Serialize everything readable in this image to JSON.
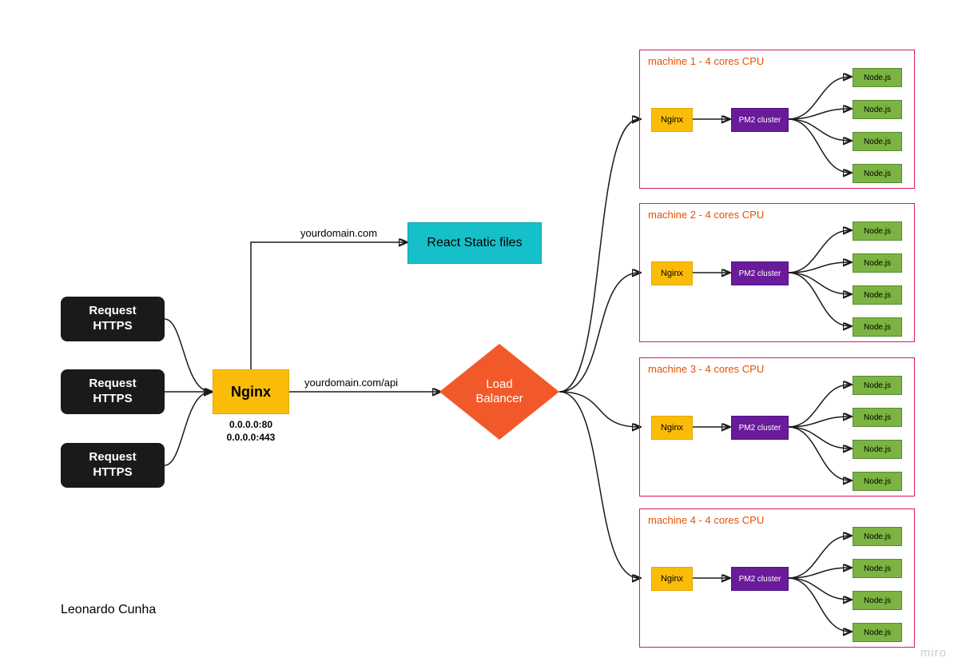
{
  "requests": [
    {
      "label": "Request\nHTTPS"
    },
    {
      "label": "Request\nHTTPS"
    },
    {
      "label": "Request\nHTTPS"
    }
  ],
  "nginx": {
    "label": "Nginx",
    "ports": "0.0.0.0:80\n0.0.0.0:443"
  },
  "routes": {
    "static": "yourdomain.com",
    "api": "yourdomain.com/api"
  },
  "react": {
    "label": "React Static files"
  },
  "loadBalancer": {
    "label": "Load\nBalancer"
  },
  "machines": [
    {
      "title": "machine 1 - 4 cores CPU",
      "nginx": "Nginx",
      "pm2": "PM2 cluster",
      "nodes": [
        "Node.js",
        "Node.js",
        "Node.js",
        "Node.js"
      ]
    },
    {
      "title": "machine 2 - 4 cores CPU",
      "nginx": "Nginx",
      "pm2": "PM2 cluster",
      "nodes": [
        "Node.js",
        "Node.js",
        "Node.js",
        "Node.js"
      ]
    },
    {
      "title": "machine 3 - 4 cores CPU",
      "nginx": "Nginx",
      "pm2": "PM2 cluster",
      "nodes": [
        "Node.js",
        "Node.js",
        "Node.js",
        "Node.js"
      ]
    },
    {
      "title": "machine 4 - 4 cores CPU",
      "nginx": "Nginx",
      "pm2": "PM2 cluster",
      "nodes": [
        "Node.js",
        "Node.js",
        "Node.js",
        "Node.js"
      ]
    }
  ],
  "author": "Leonardo Cunha",
  "watermark": "miro",
  "colors": {
    "request_bg": "#1a1a1a",
    "nginx_bg": "#fbbc09",
    "react_bg": "#16c0c8",
    "lb_bg": "#f2592a",
    "machine_border": "#d81b60",
    "machine_title": "#e65100",
    "pm2_bg": "#6a1b9a",
    "node_bg": "#7cb342"
  }
}
